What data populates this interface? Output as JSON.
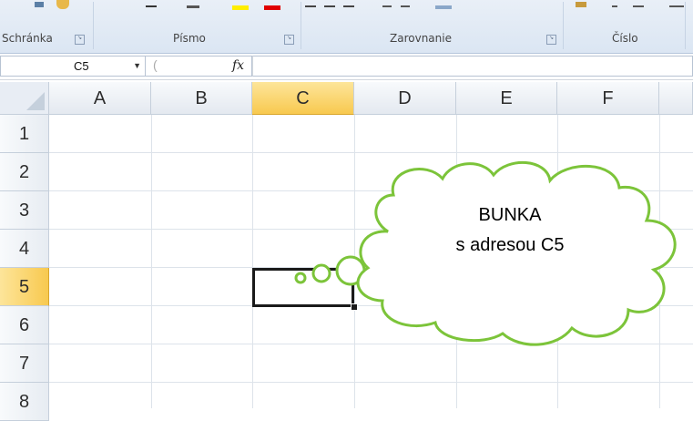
{
  "ribbon": {
    "groups": [
      {
        "label": "Schránka"
      },
      {
        "label": "Písmo"
      },
      {
        "label": "Zarovnanie"
      },
      {
        "label": "Číslo"
      }
    ]
  },
  "formula_bar": {
    "name_box_value": "C5",
    "fx_label": "fx",
    "formula_value": ""
  },
  "grid": {
    "columns": [
      "A",
      "B",
      "C",
      "D",
      "E",
      "F"
    ],
    "rows": [
      "1",
      "2",
      "3",
      "4",
      "5",
      "6",
      "7",
      "8"
    ],
    "active_column": "C",
    "active_row": "5"
  },
  "callout": {
    "line1": "BUNKA",
    "line2": "s adresou C5",
    "border_color": "#7cc43a"
  },
  "colors": {
    "highlight_header": "#f8c94f",
    "selection_border": "#1a1a1a"
  }
}
